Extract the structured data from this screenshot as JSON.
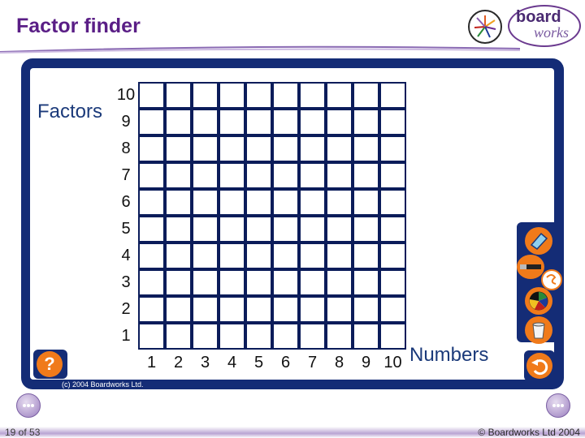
{
  "header": {
    "title": "Factor finder",
    "logo_text_1": "board",
    "logo_text_2": "works"
  },
  "axes": {
    "y_label": "Factors",
    "x_label": "Numbers",
    "y_ticks": [
      "10",
      "9",
      "8",
      "7",
      "6",
      "5",
      "4",
      "3",
      "2",
      "1"
    ],
    "x_ticks": [
      "1",
      "2",
      "3",
      "4",
      "5",
      "6",
      "7",
      "8",
      "9",
      "10"
    ]
  },
  "grid": {
    "rows": 10,
    "cols": 10
  },
  "buttons": {
    "help": "?",
    "tools": [
      {
        "name": "eraser-tool-icon"
      },
      {
        "name": "pen-tool-icon"
      },
      {
        "name": "color-wheel-icon"
      },
      {
        "name": "trash-icon"
      }
    ]
  },
  "inner_copyright": "(c) 2004 Boardworks Ltd.",
  "footer": {
    "slide_number": "19 of 53",
    "copyright": "© Boardworks Ltd 2004"
  },
  "colors": {
    "frame": "#142c76",
    "accent": "#f07a1a",
    "title": "#5a1e86"
  }
}
